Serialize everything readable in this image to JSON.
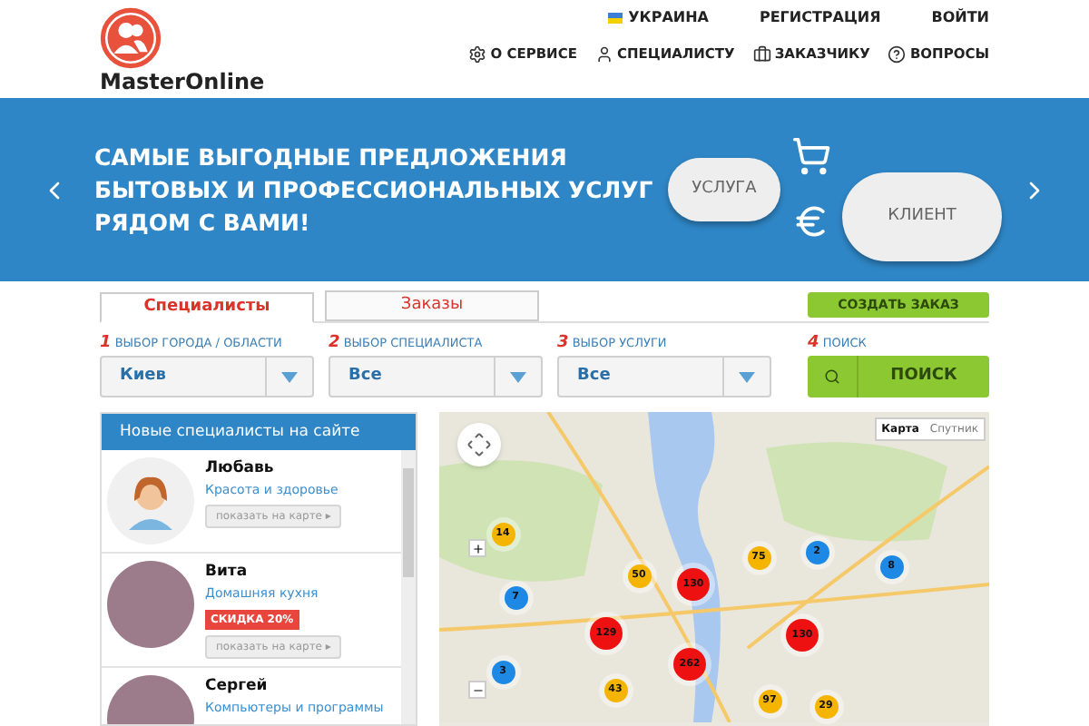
{
  "header": {
    "logo_text": "MasterOnline",
    "country": "УКРАИНА",
    "top_links": [
      "РЕГИСТРАЦИЯ",
      "ВОЙТИ"
    ],
    "nav": [
      {
        "kind": "gear",
        "label": "О СЕРВИСЕ"
      },
      {
        "kind": "user",
        "label": "СПЕЦИАЛИСТУ"
      },
      {
        "kind": "briefcase",
        "label": "ЗАКАЗЧИКУ"
      },
      {
        "kind": "question",
        "label": "ВОПРОСЫ"
      }
    ]
  },
  "banner": {
    "lines": [
      "САМЫЕ ВЫГОДНЫЕ ПРЕДЛОЖЕНИЯ",
      "БЫТОВЫХ И ПРОФЕССИОНАЛЬНЫХ УСЛУГ",
      "РЯДОМ С ВАМИ!"
    ],
    "cloud_left": "УСЛУГА",
    "cloud_right": "КЛИЕНТ"
  },
  "tabs": [
    {
      "label": "Специалисты",
      "selected": true
    },
    {
      "label": "Заказы",
      "selected": false
    }
  ],
  "create_button": "СОЗДАТЬ ЗАКАЗ",
  "filters": [
    {
      "number": "1",
      "label": "ВЫБОР ГОРОДА / ОБЛАСТИ",
      "value": "Киев"
    },
    {
      "number": "2",
      "label": "ВЫБОР СПЕЦИАЛИСТА",
      "value": "Все"
    },
    {
      "number": "3",
      "label": "ВЫБОР УСЛУГИ",
      "value": "Все"
    }
  ],
  "search": {
    "number": "4",
    "label": "ПОИСК",
    "button": "ПОИСК"
  },
  "specialists": {
    "title": "Новые специалисты на сайте",
    "items": [
      {
        "kind": "silhouette",
        "name": "Любавь",
        "category": "Красота и здоровье",
        "button": "показать на карте ▸"
      },
      {
        "kind": "photo",
        "name": "Вита",
        "category": "Домашняя кухня",
        "badge": "СКИДКА 20%",
        "button": "показать на карте ▸"
      },
      {
        "kind": "photo",
        "name": "Сергей",
        "category": "Компьютеры и программы"
      }
    ]
  },
  "map": {
    "types": [
      {
        "label": "Карта",
        "selected": true
      },
      {
        "label": "Спутник",
        "selected": false
      }
    ],
    "clusters": [
      {
        "count": "14",
        "color": "#f5b400"
      },
      {
        "count": "7",
        "color": "#1e88e5"
      },
      {
        "count": "3",
        "color": "#1e88e5"
      },
      {
        "count": "50",
        "color": "#f5b400"
      },
      {
        "count": "130",
        "color": "#ee1111"
      },
      {
        "count": "129",
        "color": "#ee1111"
      },
      {
        "count": "262",
        "color": "#ee1111"
      },
      {
        "count": "43",
        "color": "#f5b400"
      },
      {
        "count": "75",
        "color": "#f5b400"
      },
      {
        "count": "2",
        "color": "#1e88e5"
      },
      {
        "count": "8",
        "color": "#1e88e5"
      },
      {
        "count": "130",
        "color": "#ee1111"
      },
      {
        "count": "97",
        "color": "#f5b400"
      },
      {
        "count": "29",
        "color": "#f5b400"
      }
    ]
  }
}
